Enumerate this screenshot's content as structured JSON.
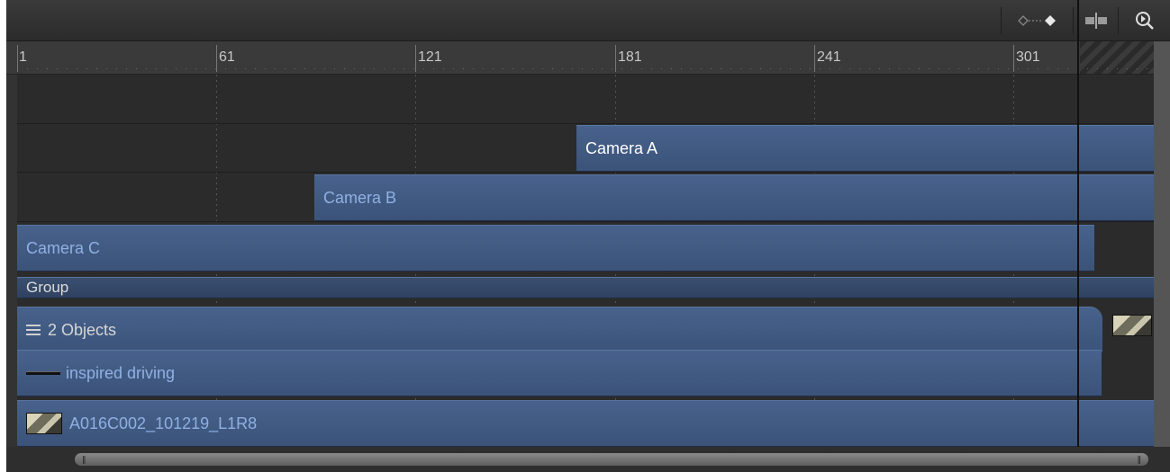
{
  "toolbar": {
    "keyframe_icon": "keyframe-navigation-icon",
    "snap_icon": "snapping-icon",
    "zoom_icon": "zoom-to-fit-icon"
  },
  "ruler": {
    "labels": [
      "1",
      "61",
      "121",
      "181",
      "241",
      "301"
    ]
  },
  "tracks": {
    "camera_a": "Camera A",
    "camera_b": "Camera B",
    "camera_c": "Camera C",
    "group": "Group",
    "objects": "2 Objects",
    "audio": "inspired driving",
    "clip": "A016C002_101219_L1R8"
  },
  "colors": {
    "track_bar": "#47628c",
    "label_dim": "#8fb0e2",
    "background": "#2b2b2b"
  }
}
